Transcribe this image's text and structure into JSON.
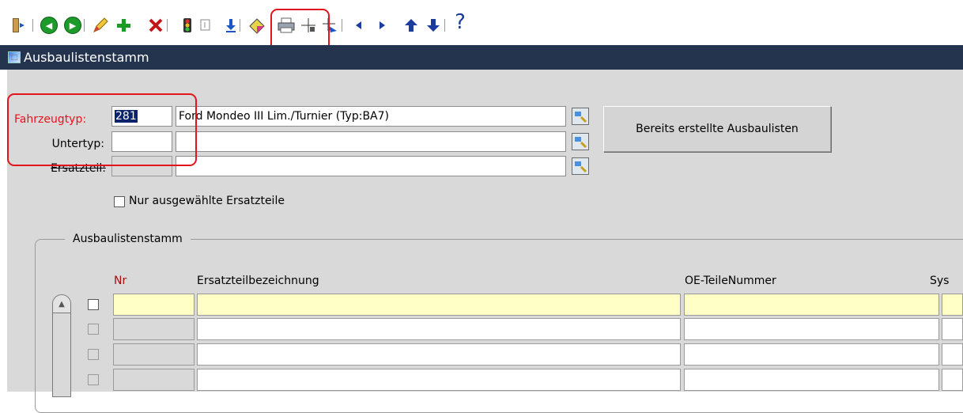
{
  "toolbar": {
    "icons": {
      "exit": "exit-door-icon",
      "prev_record": "prev-green-circle-icon",
      "next_record": "next-green-circle-icon",
      "edit": "pencil-edit-icon",
      "add": "green-plus-icon",
      "delete": "red-x-delete-icon",
      "traffic_light": "traffic-light-icon",
      "record_box": "record-box-icon",
      "download": "arrow-down-save-icon",
      "clear": "eraser-icon",
      "print": "printer-icon",
      "crosshair": "crosshair-icon",
      "crosshair_back": "crosshair-arrow-icon",
      "nav_left": "triangle-left-icon",
      "nav_right": "triangle-right-icon",
      "arrow_up": "arrow-up-icon",
      "arrow_down": "arrow-down-icon",
      "help": "help-question-icon"
    },
    "help_glyph": "?"
  },
  "window": {
    "title": "Ausbaulistenstamm"
  },
  "form": {
    "fahrzeugtyp": {
      "label": "Fahrzeugtyp:",
      "code": "281",
      "description": "Ford Mondeo III Lim./Turnier (Typ:BA7)"
    },
    "untertyp": {
      "label": "Untertyp:",
      "code": "",
      "description": ""
    },
    "ersatzteil": {
      "label": "Ersatzteil:",
      "code": "",
      "description": ""
    },
    "button_label": "Bereits erstellte Ausbaulisten",
    "checkbox_label": "Nur ausgewählte Ersatzteile"
  },
  "grid": {
    "group_title": "Ausbaulistenstamm",
    "columns": [
      "Nr",
      "Ersatzteilbezeichnung",
      "OE-TeileNummer",
      "Sys"
    ],
    "rows": [
      {
        "nr": "",
        "bezeichnung": "",
        "oe": "",
        "sys": ""
      },
      {
        "nr": "",
        "bezeichnung": "",
        "oe": "",
        "sys": ""
      },
      {
        "nr": "",
        "bezeichnung": "",
        "oe": "",
        "sys": ""
      },
      {
        "nr": "",
        "bezeichnung": "",
        "oe": "",
        "sys": ""
      }
    ]
  },
  "colors": {
    "titlebar": "#24344f",
    "required_label": "#e4141c",
    "header_nr": "#a01010",
    "highlight_row": "#ffffc6",
    "annotation": "#e4141c"
  }
}
